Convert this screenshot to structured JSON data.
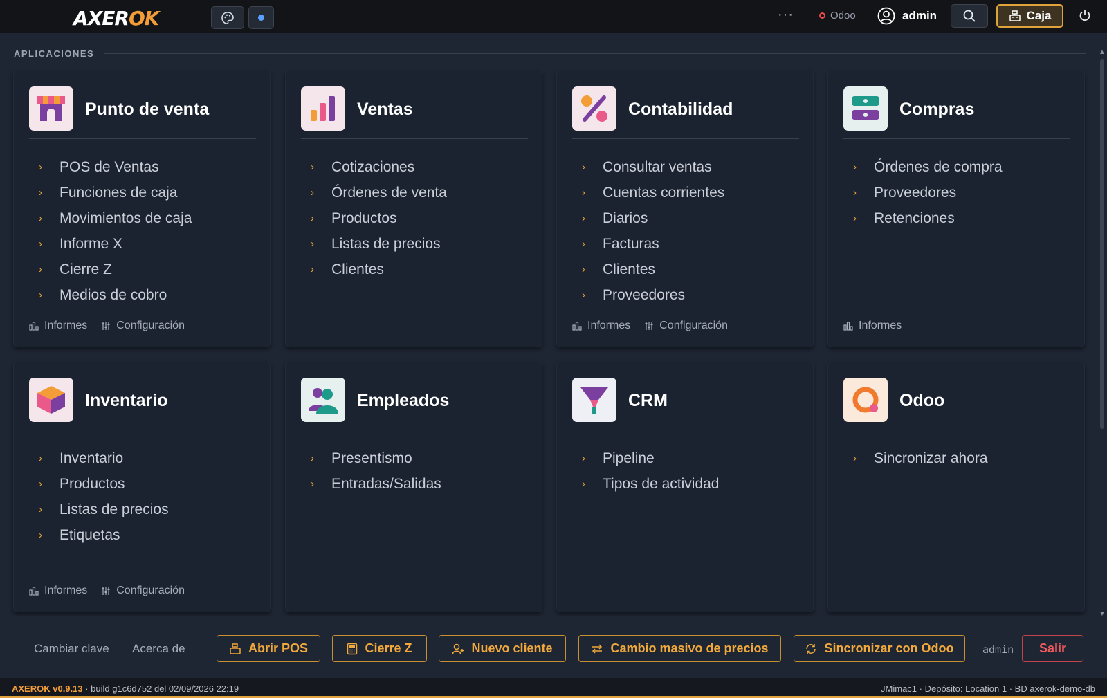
{
  "header": {
    "logo_main": "AXER",
    "logo_accent": "OK",
    "ellipsis": "···",
    "odoo_status": "Odoo",
    "user": "admin",
    "caja": "Caja",
    "colors": {
      "bar": "#121417",
      "accent": "#e0a23a",
      "status_error": "#ef4a4a"
    }
  },
  "section": {
    "title": "APLICACIONES"
  },
  "apps": [
    {
      "title": "Punto de venta",
      "icon": "store-icon",
      "items": [
        "POS de Ventas",
        "Funciones de caja",
        "Movimientos de caja",
        "Informe X",
        "Cierre Z",
        "Medios de cobro"
      ],
      "footer": [
        "Informes",
        "Configuración"
      ]
    },
    {
      "title": "Ventas",
      "icon": "bar-chart-icon",
      "items": [
        "Cotizaciones",
        "Órdenes de venta",
        "Productos",
        "Listas de precios",
        "Clientes"
      ],
      "footer": []
    },
    {
      "title": "Contabilidad",
      "icon": "percent-icon",
      "items": [
        "Consultar ventas",
        "Cuentas corrientes",
        "Diarios",
        "Facturas",
        "Clientes",
        "Proveedores"
      ],
      "footer": [
        "Informes",
        "Configuración"
      ]
    },
    {
      "title": "Compras",
      "icon": "purchase-icon",
      "items": [
        "Órdenes de compra",
        "Proveedores",
        "Retenciones"
      ],
      "footer": [
        "Informes"
      ]
    },
    {
      "title": "Inventario",
      "icon": "box-icon",
      "items": [
        "Inventario",
        "Productos",
        "Listas de precios",
        "Etiquetas"
      ],
      "footer": [
        "Informes",
        "Configuración"
      ]
    },
    {
      "title": "Empleados",
      "icon": "people-icon",
      "items": [
        "Presentismo",
        "Entradas/Salidas"
      ],
      "footer": []
    },
    {
      "title": "CRM",
      "icon": "funnel-icon",
      "items": [
        "Pipeline",
        "Tipos de actividad"
      ],
      "footer": []
    },
    {
      "title": "Odoo",
      "icon": "odoo-icon",
      "items": [
        "Sincronizar ahora"
      ],
      "footer": []
    }
  ],
  "bottom": {
    "change_password": "Cambiar clave",
    "about": "Acerca de",
    "open_pos": "Abrir POS",
    "close_z": "Cierre Z",
    "new_client": "Nuevo cliente",
    "mass_price": "Cambio masivo de precios",
    "sync_odoo": "Sincronizar con Odoo",
    "user": "admin",
    "logout": "Salir"
  },
  "status": {
    "version": "AXEROK v0.9.13",
    "build": " · build g1c6d752 del 02/09/2026 22:19",
    "right": "JMimac1 · Depósito: Location 1 · BD axerok-demo-db"
  }
}
